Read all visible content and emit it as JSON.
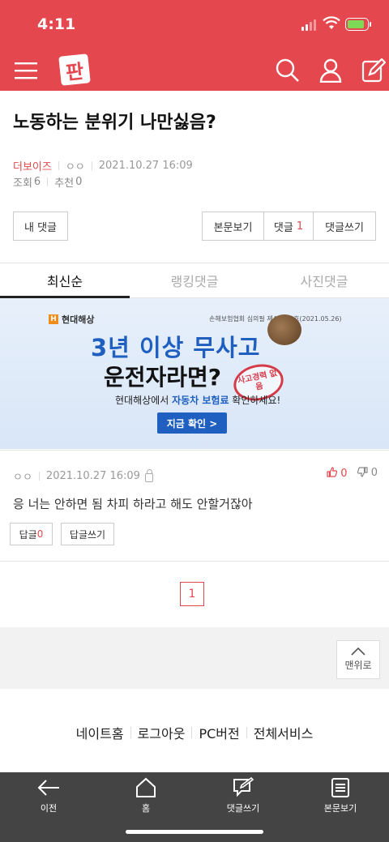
{
  "status_bar": {
    "time": "4:11"
  },
  "header": {
    "menu_icon": "hamburger-icon",
    "logo": "판",
    "search_icon": "search-icon",
    "user_icon": "user-icon",
    "write_icon": "write-icon",
    "brand_color": "#e4484e"
  },
  "post": {
    "title": "노동하는 분위기 나만싫음?",
    "author": "더보이즈",
    "nickname": "ㅇㅇ",
    "date": "2021.10.27 16:09",
    "views_label": "조회",
    "views": "6",
    "recommend_label": "추천",
    "recommend": "0"
  },
  "actions": {
    "my_comments": "내 댓글",
    "view_post": "본문보기",
    "comments_label": "댓글",
    "comments_count": "1",
    "write_comment": "댓글쓰기"
  },
  "tabs": [
    {
      "label": "최신순",
      "active": true
    },
    {
      "label": "랭킹댓글",
      "active": false
    },
    {
      "label": "사진댓글",
      "active": false
    }
  ],
  "ad": {
    "brand": "현대해상",
    "notice": "손해보험협회 심의필 제43215호(2021.05.26)",
    "headline1": "3년 이상 무사고",
    "headline2": "운전자라면?",
    "stamp": "사고경력 없음",
    "sub_prefix": "현대해상에서 ",
    "sub_highlight": "자동차 보험료",
    "sub_suffix": " 확인하세요!",
    "cta": "지금 확인 >"
  },
  "comment": {
    "nickname": "ㅇㅇ",
    "date": "2021.10.27 16:09",
    "up": "0",
    "down": "0",
    "text": "응 너는 안하면 됨 차피 하라고 해도 안할거잖아",
    "reply_label": "답글",
    "reply_count": "0",
    "reply_write": "답글쓰기"
  },
  "pagination": {
    "current": "1"
  },
  "to_top": "맨위로",
  "footer_links": [
    "네이트홈",
    "로그아웃",
    "PC버전",
    "전체서비스"
  ],
  "bottom_nav": [
    {
      "label": "이전",
      "icon": "back-arrow-icon"
    },
    {
      "label": "홈",
      "icon": "home-icon"
    },
    {
      "label": "댓글쓰기",
      "icon": "write-comment-icon"
    },
    {
      "label": "본문보기",
      "icon": "document-icon"
    }
  ]
}
